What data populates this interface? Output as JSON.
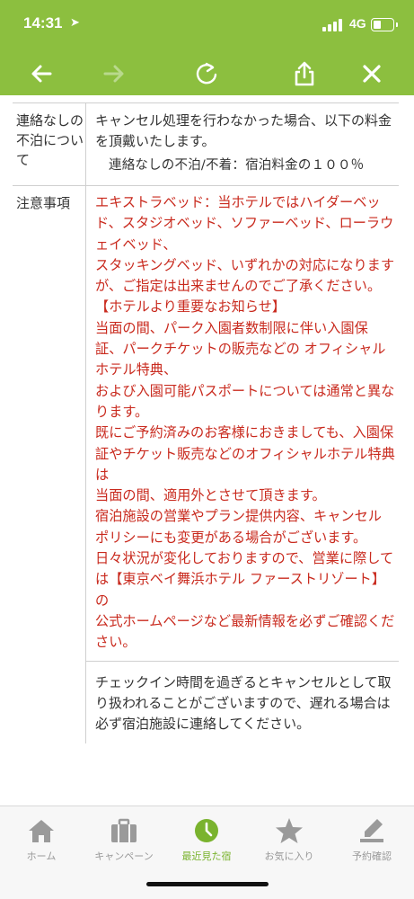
{
  "status_bar": {
    "time": "14:31",
    "network": "4G"
  },
  "toolbar": {
    "back_icon": "arrow-left-icon",
    "forward_icon": "arrow-right-icon",
    "reload_icon": "reload-icon",
    "share_icon": "share-icon",
    "close_icon": "close-icon",
    "accent_color": "#8cbf3f"
  },
  "sections": [
    {
      "label": "連絡なしの不泊について",
      "text": "キャンセル処理を行わなかった場合、以下の料金を頂戴いたします。",
      "sub": "連絡なしの不泊/不着：宿泊料金の１００％"
    },
    {
      "label": "注意事項",
      "red_text": "エキストラベッド：当ホテルではハイダーベッド、スタジオベッド、ソファーベッド、ローラウェイベッド、\nスタッキングベッド、いずれかの対応になりますが、ご指定は出来ませんのでご了承ください。\n【ホテルより重要なお知らせ】\n当面の間、パーク入園者数制限に伴い入園保証、パークチケットの販売などの オフィシャルホテル特典、\nおよび入園可能パスポートについては通常と異なります。\n既にご予約済みのお客様におきましても、入園保証やチケット販売などのオフィシャルホテル特典は\n当面の間、適用外とさせて頂きます。\n宿泊施設の営業やプラン提供内容、キャンセルポリシーにも変更がある場合がございます。\n日々状況が変化しておりますので、営業に際しては【東京ベイ舞浜ホテル ファーストリゾート】の\n公式ホームページなど最新情報を必ずご確認ください。",
      "extra_text": "チェックイン時間を過ぎるとキャンセルとして取り扱われることがございますので、遅れる場合は必ず宿泊施設に連絡してください。",
      "red_color": "#c92a1e"
    }
  ],
  "tabs": [
    {
      "label": "ホーム",
      "icon": "home-icon"
    },
    {
      "label": "キャンペーン",
      "icon": "briefcase-icon"
    },
    {
      "label": "最近見た宿",
      "icon": "clock-icon",
      "active": true
    },
    {
      "label": "お気に入り",
      "icon": "star-icon"
    },
    {
      "label": "予約確認",
      "icon": "pen-icon"
    }
  ]
}
